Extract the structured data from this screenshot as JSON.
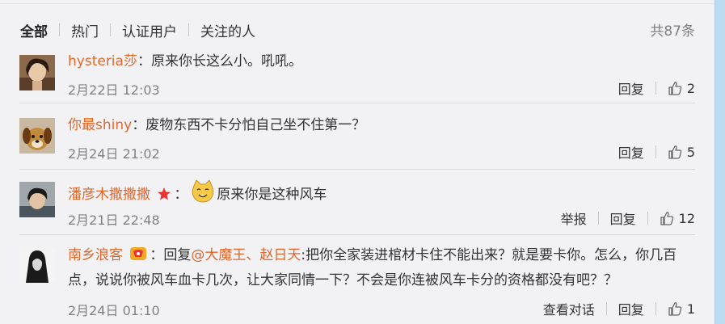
{
  "tabs": [
    {
      "label": "全部",
      "active": true
    },
    {
      "label": "热门",
      "active": false
    },
    {
      "label": "认证用户",
      "active": false
    },
    {
      "label": "关注的人",
      "active": false
    }
  ],
  "total": "共87条",
  "comments": [
    {
      "user": "hysteria莎",
      "separator": "：",
      "text": "原来你长这么小。吼吼。",
      "time": "2月22日 12:03",
      "reply_label": "回复",
      "likes": "2"
    },
    {
      "user": "你最shiny",
      "separator": "：",
      "text": "废物东西不卡分怕自己坐不住第一？",
      "time": "2月24日 21:02",
      "reply_label": "回复",
      "likes": "5"
    },
    {
      "user": "潘彦木撒撒撒",
      "separator": "：",
      "text": "原来你是这种风车",
      "time": "2月21日 22:48",
      "report_label": "举报",
      "reply_label": "回复",
      "likes": "12"
    },
    {
      "user": "南乡浪客",
      "separator": "：",
      "reply_prefix": "回复",
      "mention": "@大魔王、赵日天",
      "text_line1": ":把你全家装进棺材卡住不能出来？就是要卡你。怎么，你几百",
      "text_line2": "点，说说你被风车血卡几次，让大家同情一下？不会是你连被风车卡分的资格都没有吧？？",
      "time": "2月24日 01:10",
      "view_conversation_label": "查看对话",
      "reply_label": "回复",
      "likes": "1"
    }
  ],
  "colors": {
    "username": "#e0662a",
    "meta": "#808080",
    "badge_red": "#e8322c",
    "badge_vip": "#f5a623"
  },
  "icons": [
    "thumbs-up-icon",
    "star-badge-icon",
    "vip-badge-icon",
    "smiley-cat-emoji"
  ]
}
